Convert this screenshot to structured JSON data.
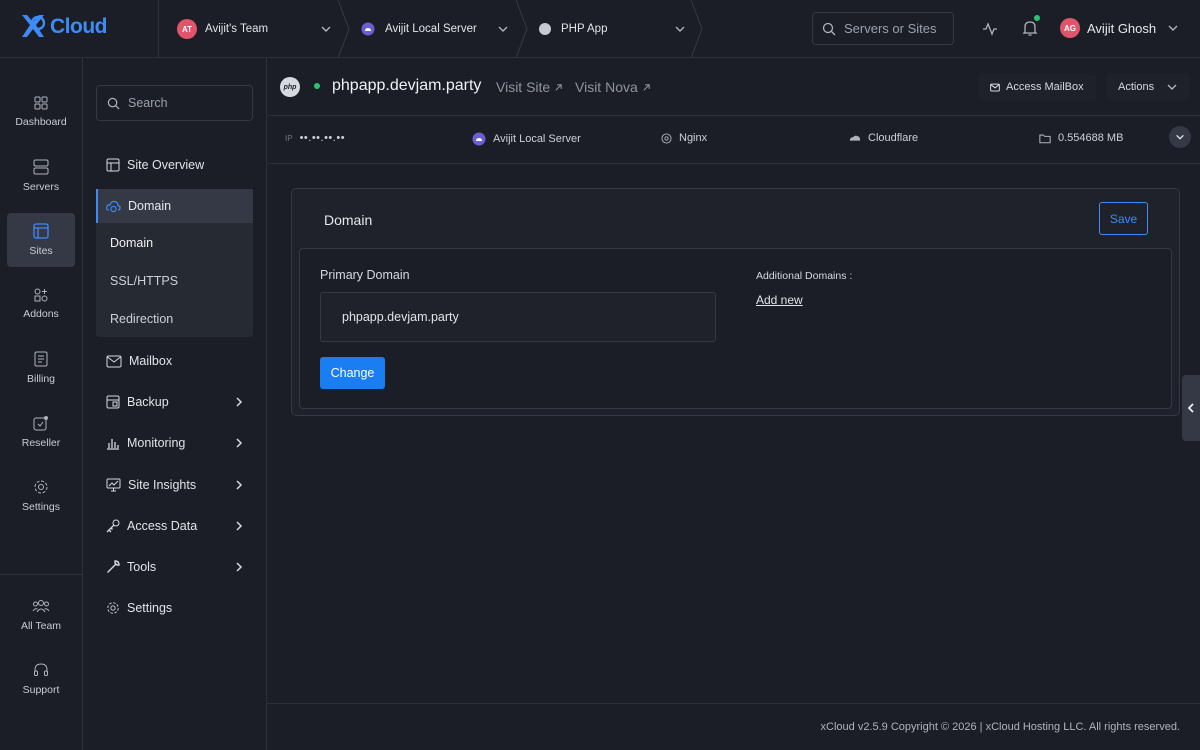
{
  "brand": {
    "logo_text": "Cloud",
    "accent": "#3d8cf5"
  },
  "topbar": {
    "team": {
      "initials": "AT",
      "label": "Avijit's Team"
    },
    "server": {
      "label": "Avijit Local Server"
    },
    "app": {
      "label": "PHP App"
    },
    "search_placeholder": "Servers or Sites",
    "user": {
      "initials": "AG",
      "name": "Avijit Ghosh"
    }
  },
  "rail": {
    "items": [
      {
        "label": "Dashboard",
        "icon": "dashboard-icon"
      },
      {
        "label": "Servers",
        "icon": "server-icon"
      },
      {
        "label": "Sites",
        "icon": "sites-icon"
      },
      {
        "label": "Addons",
        "icon": "addons-icon"
      },
      {
        "label": "Billing",
        "icon": "billing-icon"
      },
      {
        "label": "Reseller",
        "icon": "reseller-icon"
      },
      {
        "label": "Settings",
        "icon": "gear-icon"
      }
    ],
    "bottom": [
      {
        "label": "All Team",
        "icon": "team-icon"
      },
      {
        "label": "Support",
        "icon": "headset-icon"
      }
    ]
  },
  "subnav": {
    "search_placeholder": "Search",
    "site_overview": "Site Overview",
    "domain_group": {
      "label": "Domain",
      "children": [
        "Domain",
        "SSL/HTTPS",
        "Redirection"
      ]
    },
    "mailbox": "Mailbox",
    "backup": "Backup",
    "monitoring": "Monitoring",
    "site_insights": "Site Insights",
    "access_data": "Access Data",
    "tools": "Tools",
    "settings": "Settings"
  },
  "site": {
    "badge": "php",
    "title": "phpapp.devjam.party",
    "visit_site": "Visit Site",
    "visit_nova": "Visit Nova",
    "access_mailbox": "Access MailBox",
    "actions": "Actions"
  },
  "info": {
    "ip_label": "IP",
    "ip_value": "••.••.••.••",
    "server": "Avijit Local Server",
    "web_server": "Nginx",
    "dns": "Cloudflare",
    "size": "0.554688 MB"
  },
  "domain_card": {
    "title": "Domain",
    "save": "Save",
    "primary_label": "Primary Domain",
    "primary_value": "phpapp.devjam.party",
    "change": "Change",
    "additional_label": "Additional Domains :",
    "add_new": "Add new"
  },
  "footer": {
    "text": "xCloud v2.5.9 Copyright © 2026 | xCloud Hosting LLC. All rights reserved."
  }
}
